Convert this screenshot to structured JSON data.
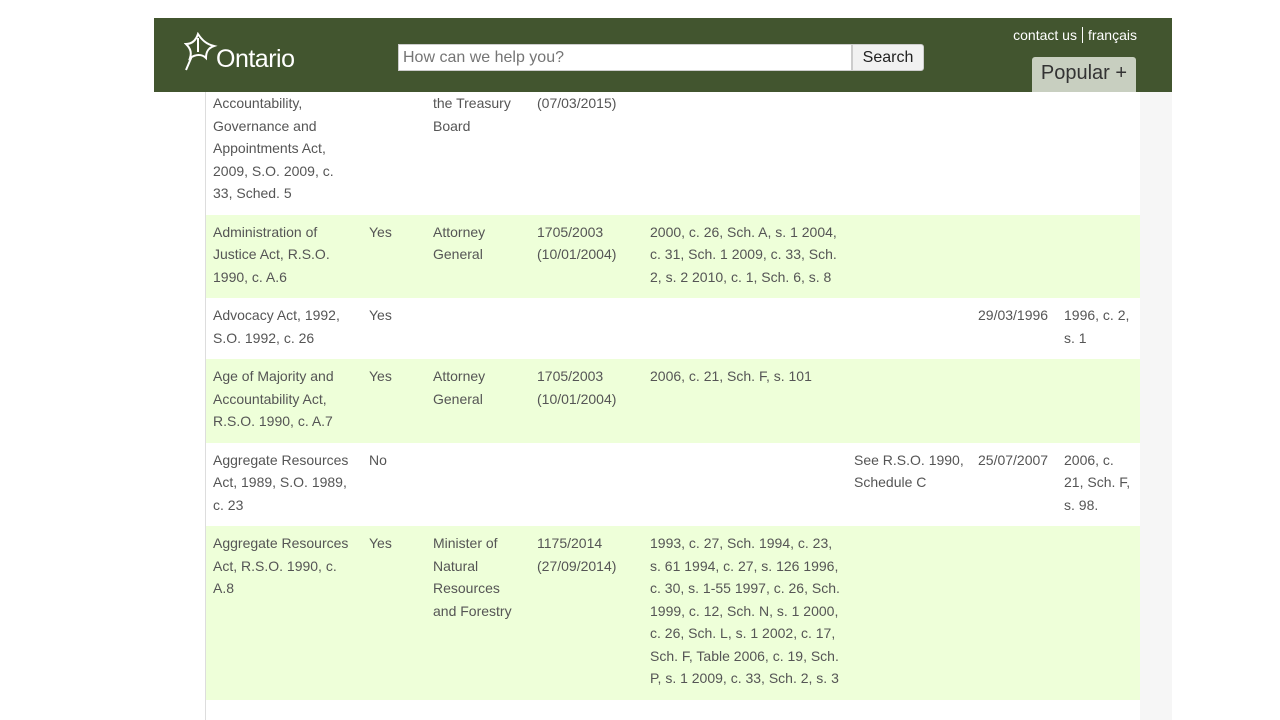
{
  "header": {
    "logo": "Ontario",
    "search_placeholder": "How can we help you?",
    "search_button": "Search",
    "contact": "contact us",
    "francais": "français",
    "popular": "Popular +"
  },
  "colors": {
    "header": "#42552f",
    "row_alt": "#eeffd9",
    "tab": "#c8cfc0"
  },
  "rows": [
    [
      "Accountability, Governance and Appointments Act, 2009, S.O. 2009, c. 33, Sched. 5",
      "",
      "the Treasury Board",
      "(07/03/2015)",
      "",
      "",
      "",
      ""
    ],
    [
      "Administration of Justice Act, R.S.O. 1990, c. A.6",
      "Yes",
      "Attorney General",
      "1705/2003 (10/01/2004)",
      "2000, c. 26, Sch. A, s. 1 2004, c. 31, Sch. 1 2009, c. 33, Sch. 2, s. 2 2010, c. 1, Sch. 6, s. 8",
      "",
      "",
      ""
    ],
    [
      "Advocacy Act, 1992, S.O. 1992, c. 26",
      "Yes",
      "",
      "",
      "",
      "",
      "29/03/1996",
      "1996, c. 2, s. 1"
    ],
    [
      "Age of Majority and Accountability Act, R.S.O. 1990, c. A.7",
      "Yes",
      "Attorney General",
      "1705/2003 (10/01/2004)",
      "2006, c. 21, Sch. F, s. 101",
      "",
      "",
      ""
    ],
    [
      "Aggregate Resources Act, 1989, S.O. 1989, c. 23",
      "No",
      "",
      "",
      "",
      "See R.S.O. 1990, Schedule C",
      "25/07/2007",
      "2006, c. 21, Sch. F, s. 98."
    ],
    [
      "Aggregate Resources Act, R.S.O. 1990, c. A.8",
      "Yes",
      "Minister of Natural Resources and Forestry",
      "1175/2014 (27/09/2014)",
      "1993, c. 27, Sch. 1994, c. 23, s. 61 1994, c. 27, s. 126 1996, c. 30, s. 1-55 1997, c. 26, Sch. 1999, c. 12, Sch. N, s. 1 2000, c. 26, Sch. L, s. 1 2002, c. 17, Sch. F, Table 2006, c. 19, Sch. P, s. 1 2009, c. 33, Sch. 2, s. 3",
      "",
      "",
      ""
    ]
  ]
}
